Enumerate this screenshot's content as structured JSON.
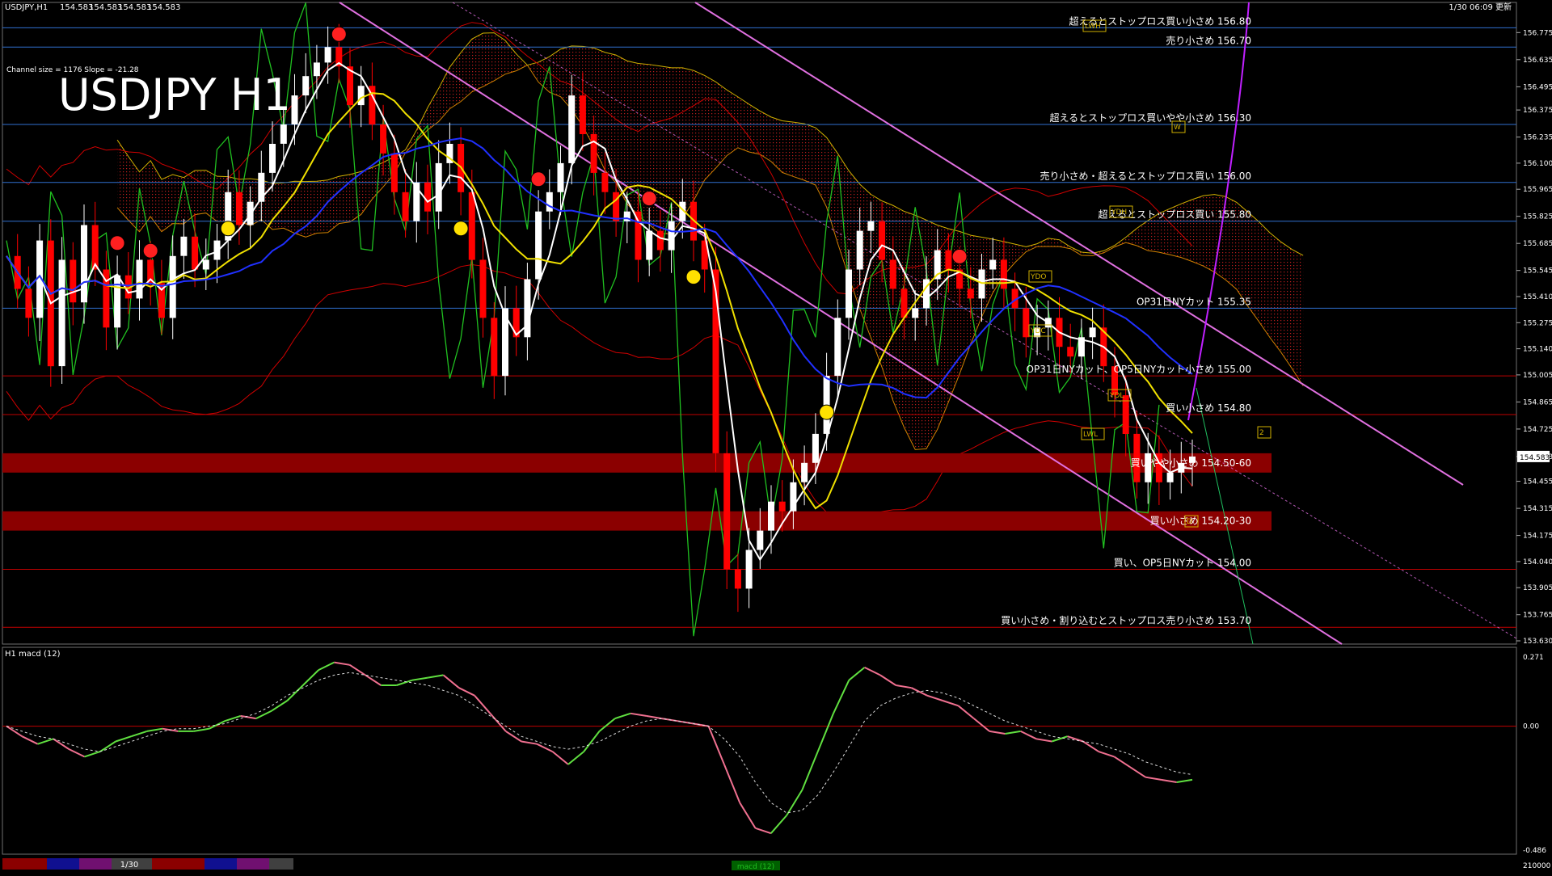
{
  "header": {
    "symbol_info": "USDJPY,H1",
    "ohlc": [
      "154.583",
      "154.583",
      "154.583",
      "154.583"
    ],
    "datetime": "1/30 06:09 更新",
    "title": "USDJPY H1",
    "channel_info": "Channel size = 1176  Slope = -21.28"
  },
  "colors": {
    "background": "#000000",
    "bull_candle": "#ffffff",
    "bear_candle": "#ff0000",
    "blue_level": "#3070d0",
    "red_level": "#c00000",
    "zone": "#8b0000",
    "channel": "#e070e0",
    "ma_white": "#ffffff",
    "ma_yellow": "#f0e000",
    "ma_blue": "#2030ff",
    "kumo": "#c00000",
    "chikou": "#20c020",
    "bollinger": "#d00000",
    "macd_up": "#60e040",
    "macd_down": "#f07090",
    "grid": "#404040"
  },
  "chart_data": [
    {
      "type": "line",
      "name": "price",
      "ylim": [
        153.63,
        156.86
      ],
      "yticks": [
        "156.775",
        "156.635",
        "156.495",
        "156.375",
        "156.235",
        "156.100",
        "155.965",
        "155.825",
        "155.685",
        "155.545",
        "155.410",
        "155.275",
        "155.140",
        "155.005",
        "154.865",
        "154.725",
        "154.583",
        "154.455",
        "154.315",
        "154.175",
        "154.040",
        "153.905",
        "153.765",
        "153.630"
      ],
      "current_price": "154.583",
      "price_path": [
        155.62,
        155.45,
        155.3,
        155.7,
        155.05,
        155.6,
        155.38,
        155.78,
        155.55,
        155.25,
        155.52,
        155.4,
        155.6,
        155.48,
        155.3,
        155.62,
        155.72,
        155.55,
        155.6,
        155.7,
        155.95,
        155.78,
        155.9,
        156.05,
        156.2,
        156.3,
        156.45,
        156.55,
        156.62,
        156.7,
        156.6,
        156.4,
        156.5,
        156.3,
        156.15,
        155.95,
        155.8,
        156.0,
        155.85,
        156.1,
        156.2,
        155.95,
        155.6,
        155.3,
        155.0,
        155.35,
        155.2,
        155.5,
        155.85,
        155.95,
        156.1,
        156.45,
        156.25,
        156.05,
        155.95,
        155.8,
        155.85,
        155.6,
        155.75,
        155.65,
        155.8,
        155.9,
        155.7,
        155.55,
        154.6,
        154.0,
        153.9,
        154.1,
        154.2,
        154.35,
        154.3,
        154.45,
        154.55,
        154.7,
        155.0,
        155.3,
        155.55,
        155.75,
        155.8,
        155.6,
        155.45,
        155.3,
        155.35,
        155.5,
        155.65,
        155.55,
        155.45,
        155.4,
        155.55,
        155.6,
        155.45,
        155.35,
        155.2,
        155.25,
        155.3,
        155.15,
        155.1,
        155.2,
        155.25,
        155.05,
        154.9,
        154.7,
        154.45,
        154.6,
        154.45,
        154.5,
        154.55,
        154.583
      ],
      "levels": [
        {
          "price": 156.8,
          "label": "超えるとストップロス買い小さめ 156.80",
          "color": "blue"
        },
        {
          "price": 156.7,
          "label": "売り小さめ 156.70",
          "color": "blue"
        },
        {
          "price": 156.3,
          "label": "超えるとストップロス買いやや小さめ 156.30",
          "color": "blue"
        },
        {
          "price": 156.0,
          "label": "売り小さめ・超えるとストップロス買い 156.00",
          "color": "blue"
        },
        {
          "price": 155.8,
          "label": "超えるとストップロス買い 155.80",
          "color": "blue"
        },
        {
          "price": 155.35,
          "label": "OP31日NYカット 155.35",
          "color": "blue"
        },
        {
          "price": 155.0,
          "label": "OP31日NYカット、OP5日NYカット小さめ 155.00",
          "color": "red"
        },
        {
          "price": 154.8,
          "label": "買い小さめ 154.80",
          "color": "red"
        },
        {
          "price": 154.0,
          "label": "買い、OP5日NYカット 154.00",
          "color": "red"
        },
        {
          "price": 153.7,
          "label": "買い小さめ・割り込むとストップロス売り小さめ 153.70",
          "color": "red"
        }
      ],
      "zones": [
        {
          "low": 154.5,
          "high": 154.6,
          "label": "買いやや小さめ 154.50-60"
        },
        {
          "low": 154.2,
          "high": 154.3,
          "label": "買い小さめ 154.20-30"
        }
      ],
      "tags": [
        "LWH",
        "W",
        "YDH",
        "YDO",
        "YDC",
        "YDL",
        "LWL",
        "D",
        "2"
      ]
    },
    {
      "type": "line",
      "name": "macd",
      "title": "H1  macd (12)",
      "ylim": [
        -0.486,
        0.271
      ],
      "yticks": [
        "0.271",
        "0.00",
        "-0.486"
      ],
      "macd": [
        0.0,
        -0.04,
        -0.07,
        -0.05,
        -0.09,
        -0.12,
        -0.1,
        -0.06,
        -0.04,
        -0.02,
        -0.01,
        -0.02,
        -0.02,
        -0.01,
        0.02,
        0.04,
        0.03,
        0.06,
        0.1,
        0.16,
        0.22,
        0.25,
        0.24,
        0.2,
        0.16,
        0.16,
        0.18,
        0.19,
        0.2,
        0.15,
        0.12,
        0.05,
        -0.02,
        -0.06,
        -0.07,
        -0.1,
        -0.15,
        -0.1,
        -0.02,
        0.03,
        0.05,
        0.04,
        0.03,
        0.02,
        0.01,
        0.0,
        -0.15,
        -0.3,
        -0.4,
        -0.42,
        -0.35,
        -0.25,
        -0.1,
        0.05,
        0.18,
        0.23,
        0.2,
        0.16,
        0.15,
        0.12,
        0.1,
        0.08,
        0.03,
        -0.02,
        -0.03,
        -0.02,
        -0.05,
        -0.06,
        -0.04,
        -0.06,
        -0.1,
        -0.12,
        -0.16,
        -0.2,
        -0.21,
        -0.22,
        -0.21
      ],
      "signal": [
        0.0,
        -0.02,
        -0.04,
        -0.05,
        -0.07,
        -0.09,
        -0.1,
        -0.08,
        -0.06,
        -0.04,
        -0.02,
        -0.01,
        -0.01,
        0.0,
        0.01,
        0.03,
        0.05,
        0.08,
        0.12,
        0.15,
        0.18,
        0.2,
        0.21,
        0.2,
        0.19,
        0.18,
        0.17,
        0.16,
        0.14,
        0.12,
        0.08,
        0.04,
        0.0,
        -0.04,
        -0.06,
        -0.08,
        -0.09,
        -0.08,
        -0.06,
        -0.03,
        0.0,
        0.02,
        0.03,
        0.02,
        0.01,
        0.0,
        -0.05,
        -0.12,
        -0.22,
        -0.3,
        -0.34,
        -0.33,
        -0.27,
        -0.18,
        -0.08,
        0.02,
        0.08,
        0.11,
        0.13,
        0.14,
        0.13,
        0.11,
        0.08,
        0.05,
        0.02,
        0.0,
        -0.02,
        -0.04,
        -0.05,
        -0.06,
        -0.07,
        -0.09,
        -0.11,
        -0.14,
        -0.16,
        -0.18,
        -0.19
      ]
    }
  ],
  "footer": {
    "date_label": "1/30",
    "indicator_tab": "macd (12)",
    "right_value": "210000"
  }
}
